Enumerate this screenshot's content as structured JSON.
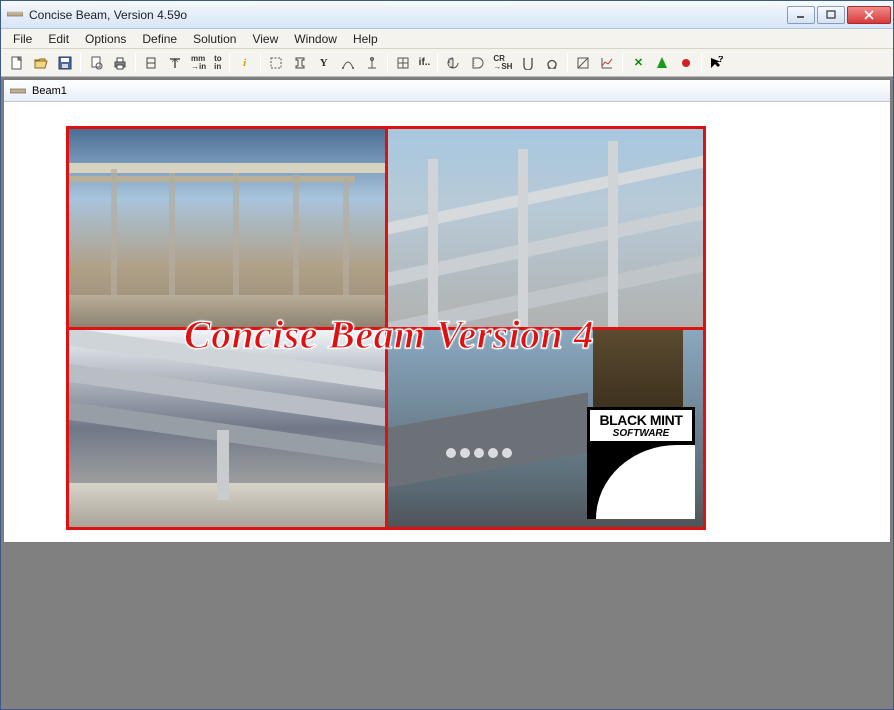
{
  "window": {
    "title": "Concise Beam, Version 4.59o"
  },
  "menu": {
    "items": [
      "File",
      "Edit",
      "Options",
      "Define",
      "Solution",
      "View",
      "Window",
      "Help"
    ]
  },
  "toolbar": {
    "groups": [
      [
        "new",
        "open",
        "save"
      ],
      [
        "preview",
        "print"
      ],
      [
        "section",
        "tee",
        "mm-in",
        "to-in"
      ],
      [
        "info"
      ],
      [
        "rect-dashed",
        "I",
        "Y",
        "arc",
        "anchor"
      ],
      [
        "grid",
        "if.."
      ],
      [
        "d-rot",
        "d-section",
        "cr-sh",
        "u-shape",
        "omega"
      ],
      [
        "diag",
        "chart"
      ],
      [
        "cross-green",
        "tree-green",
        "dot-red"
      ],
      [
        "help-arrow"
      ]
    ]
  },
  "subwindow": {
    "title": "Beam1"
  },
  "splash": {
    "title": "Concise Beam Version 4",
    "logo": {
      "line1": "BLACK MINT",
      "line2": "SOFTWARE"
    }
  }
}
